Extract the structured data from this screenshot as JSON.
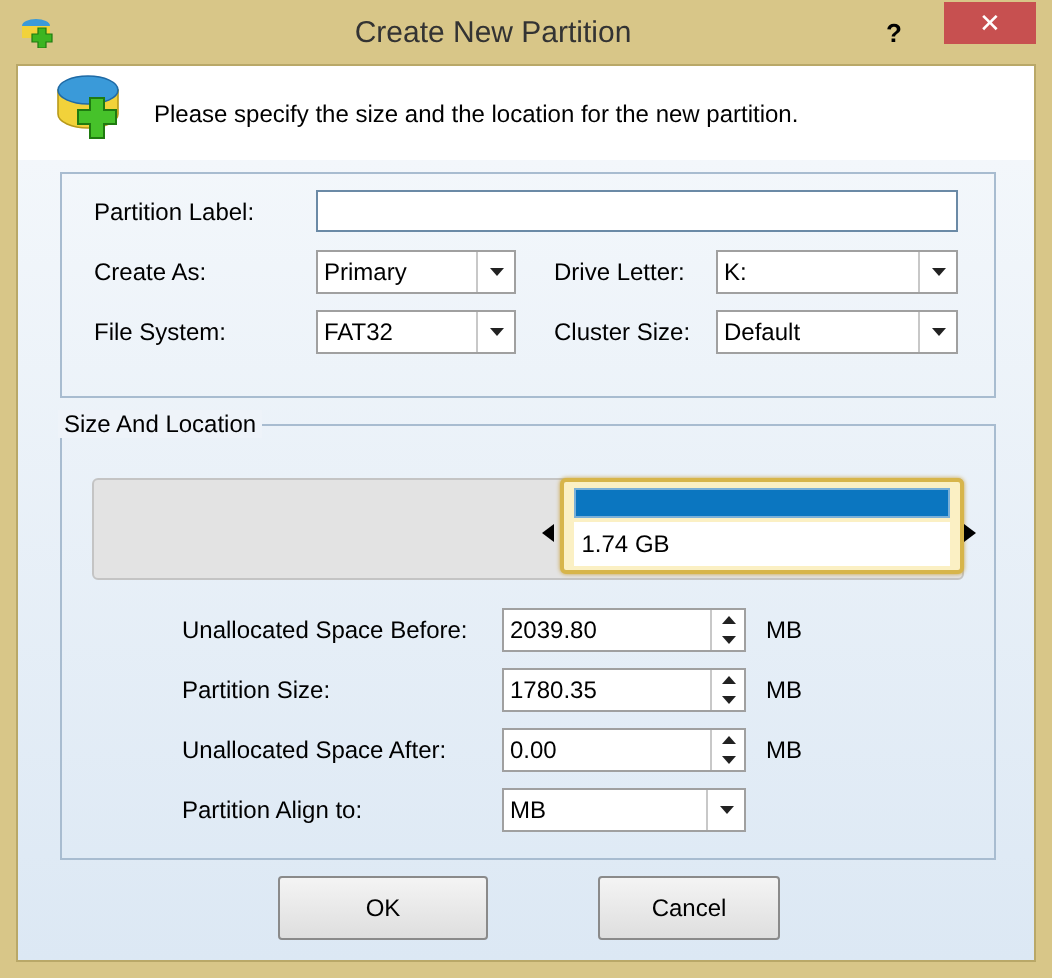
{
  "window": {
    "title": "Create New Partition",
    "help_button": "?",
    "close_button": "✕"
  },
  "intro": "Please specify the size and the location for the new partition.",
  "general": {
    "partition_label": {
      "label": "Partition Label:"
    },
    "create_as": {
      "label": "Create As:",
      "value": "Primary"
    },
    "drive_letter": {
      "label": "Drive Letter:",
      "value": "K:"
    },
    "file_system": {
      "label": "File System:",
      "value": "FAT32"
    },
    "cluster_size": {
      "label": "Cluster Size:",
      "value": "Default"
    }
  },
  "size_and_location": {
    "title": "Size And Location",
    "partition_map": {
      "size": "1.74 GB",
      "selected": true
    },
    "fields": [
      {
        "kind": "spin",
        "label": "Unallocated Space Before:",
        "value": "2039.80",
        "unit": "MB"
      },
      {
        "kind": "spin",
        "label": "Partition Size:",
        "value": "1780.35",
        "unit": "MB"
      },
      {
        "kind": "spin",
        "label": "Unallocated Space After:",
        "value": "0.00",
        "unit": "MB"
      },
      {
        "kind": "combo",
        "label": "Partition Align to:",
        "value": "MB"
      }
    ]
  },
  "buttons": [
    "OK",
    "Cancel"
  ]
}
